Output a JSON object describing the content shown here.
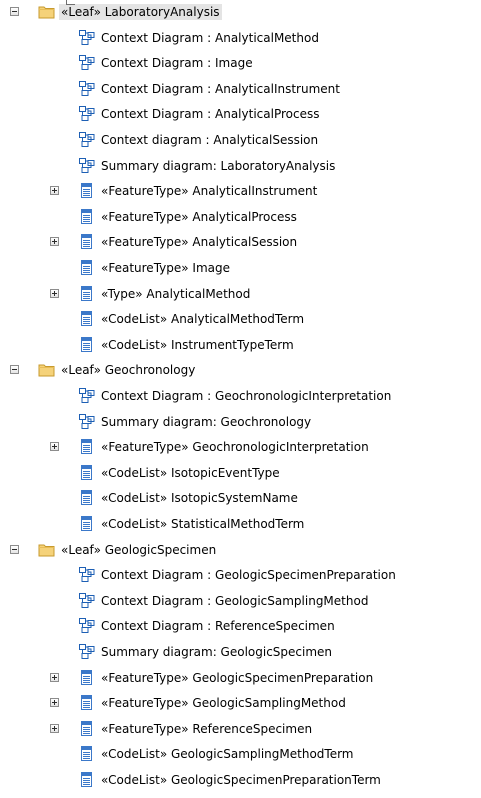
{
  "tree": [
    {
      "level": 0,
      "kind": "package",
      "toggle": "minus",
      "label": "«Leaf» LaboratoryAnalysis",
      "selected": true
    },
    {
      "level": 1,
      "kind": "diagram",
      "label": "Context Diagram : AnalyticalMethod"
    },
    {
      "level": 1,
      "kind": "diagram",
      "label": "Context Diagram : Image"
    },
    {
      "level": 1,
      "kind": "diagram",
      "label": "Context Diagram : AnalyticalInstrument"
    },
    {
      "level": 1,
      "kind": "diagram",
      "label": "Context Diagram : AnalyticalProcess"
    },
    {
      "level": 1,
      "kind": "diagram",
      "label": "Context diagram : AnalyticalSession"
    },
    {
      "level": 1,
      "kind": "diagram",
      "label": "Summary diagram: LaboratoryAnalysis"
    },
    {
      "level": 1,
      "kind": "class",
      "toggle": "plus",
      "label": "«FeatureType» AnalyticalInstrument"
    },
    {
      "level": 1,
      "kind": "class",
      "label": "«FeatureType» AnalyticalProcess"
    },
    {
      "level": 1,
      "kind": "class",
      "toggle": "plus",
      "label": "«FeatureType» AnalyticalSession"
    },
    {
      "level": 1,
      "kind": "class",
      "label": "«FeatureType» Image"
    },
    {
      "level": 1,
      "kind": "class",
      "toggle": "plus",
      "label": "«Type» AnalyticalMethod"
    },
    {
      "level": 1,
      "kind": "class",
      "label": "«CodeList» AnalyticalMethodTerm"
    },
    {
      "level": 1,
      "kind": "class",
      "label": "«CodeList» InstrumentTypeTerm"
    },
    {
      "level": 0,
      "kind": "package",
      "toggle": "minus",
      "label": "«Leaf» Geochronology"
    },
    {
      "level": 1,
      "kind": "diagram",
      "label": "Context Diagram : GeochronologicInterpretation"
    },
    {
      "level": 1,
      "kind": "diagram",
      "label": "Summary diagram: Geochronology"
    },
    {
      "level": 1,
      "kind": "class",
      "toggle": "plus",
      "label": "«FeatureType» GeochronologicInterpretation"
    },
    {
      "level": 1,
      "kind": "class",
      "label": "«CodeList» IsotopicEventType"
    },
    {
      "level": 1,
      "kind": "class",
      "label": "«CodeList» IsotopicSystemName"
    },
    {
      "level": 1,
      "kind": "class",
      "label": "«CodeList» StatisticalMethodTerm"
    },
    {
      "level": 0,
      "kind": "package",
      "toggle": "minus",
      "label": "«Leaf» GeologicSpecimen"
    },
    {
      "level": 1,
      "kind": "diagram",
      "label": "Context Diagram : GeologicSpecimenPreparation"
    },
    {
      "level": 1,
      "kind": "diagram",
      "label": "Context Diagram : GeologicSamplingMethod"
    },
    {
      "level": 1,
      "kind": "diagram",
      "label": "Context Diagram : ReferenceSpecimen"
    },
    {
      "level": 1,
      "kind": "diagram",
      "label": "Summary diagram: GeologicSpecimen"
    },
    {
      "level": 1,
      "kind": "class",
      "toggle": "plus",
      "label": "«FeatureType» GeologicSpecimenPreparation"
    },
    {
      "level": 1,
      "kind": "class",
      "toggle": "plus",
      "label": "«FeatureType» GeologicSamplingMethod"
    },
    {
      "level": 1,
      "kind": "class",
      "toggle": "plus",
      "label": "«FeatureType» ReferenceSpecimen"
    },
    {
      "level": 1,
      "kind": "class",
      "label": "«CodeList» GeologicSamplingMethodTerm"
    },
    {
      "level": 1,
      "kind": "class",
      "label": "«CodeList» GeologicSpecimenPreparationTerm"
    }
  ],
  "icons": {
    "package": "folder-icon",
    "diagram": "diagram-icon",
    "class": "class-icon"
  },
  "colors": {
    "selection": "#e4e4e4",
    "folder": "#f5d27a",
    "diagram": "#1d5fb4",
    "class": "#3b78c9"
  }
}
